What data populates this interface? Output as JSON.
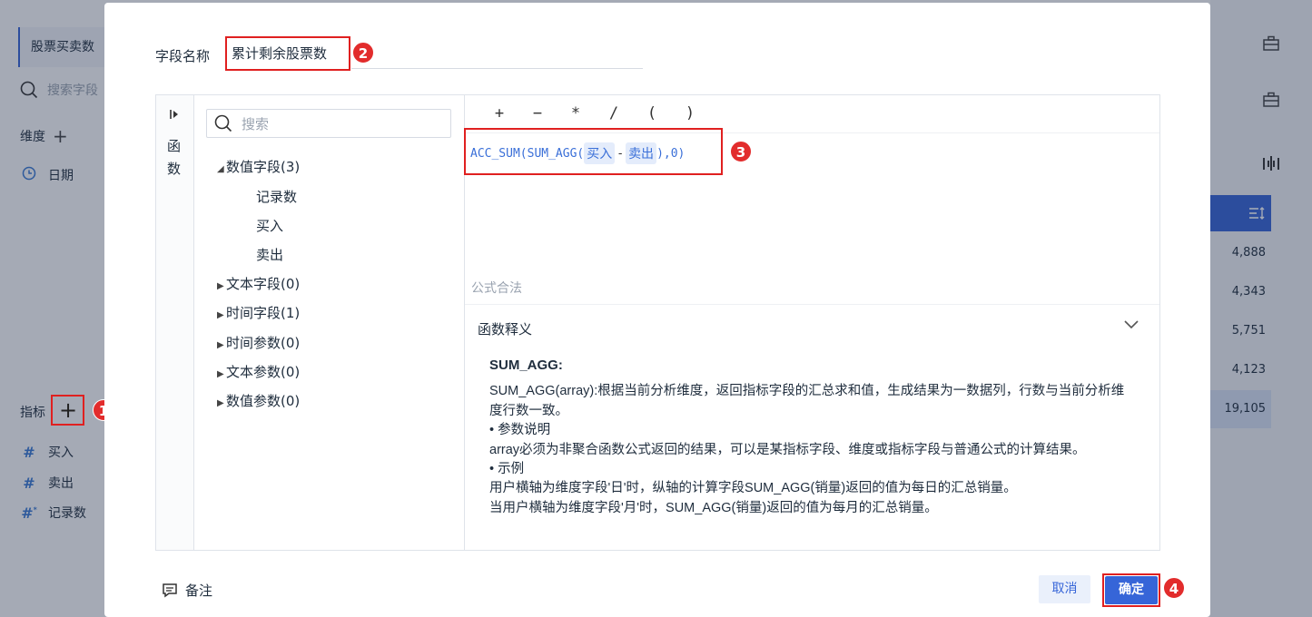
{
  "background": {
    "dataset_tab": "股票买卖数",
    "search_placeholder": "搜索字段",
    "dimension_label": "维度",
    "dimension_fields": [
      "日期"
    ],
    "metric_label": "指标",
    "metric_fields": [
      "买入",
      "卖出",
      "记录数"
    ],
    "table_values": [
      "4,888",
      "4,343",
      "5,751",
      "4,123"
    ],
    "table_total": "19,105"
  },
  "dialog": {
    "name_label": "字段名称",
    "name_value": "累计剩余股票数",
    "side_tab": "函数",
    "tree_search_placeholder": "搜索",
    "tree": {
      "numeric_group": "数值字段(3)",
      "numeric_children": [
        "记录数",
        "买入",
        "卖出"
      ],
      "text_group": "文本字段(0)",
      "time_group": "时间字段(1)",
      "time_param_group": "时间参数(0)",
      "text_param_group": "文本参数(0)",
      "numeric_param_group": "数值参数(0)"
    },
    "operators": [
      "+",
      "−",
      "*",
      "/",
      "(",
      ")"
    ],
    "formula": {
      "prefix": "ACC_SUM(SUM_AGG(",
      "field1": "买入",
      "minus": "-",
      "field2": "卖出",
      "suffix": "),0)"
    },
    "status": "公式合法",
    "explain_title": "函数释义",
    "explain": {
      "name": "SUM_AGG:",
      "lines": [
        "SUM_AGG(array):根据当前分析维度，返回指标字段的汇总求和值，生成结果为一数据列，行数与当前分析维度行数一致。",
        "• 参数说明",
        "array必须为非聚合函数公式返回的结果，可以是某指标字段、维度或指标字段与普通公式的计算结果。",
        "• 示例",
        "用户横轴为维度字段'日'时，纵轴的计算字段SUM_AGG(销量)返回的值为每日的汇总销量。",
        "当用户横轴为维度字段'月'时，SUM_AGG(销量)返回的值为每月的汇总销量。"
      ]
    },
    "note_label": "备注",
    "cancel_label": "取消",
    "ok_label": "确定"
  },
  "badges": [
    "1",
    "2",
    "3",
    "4"
  ],
  "colors": {
    "primary": "#3665d8",
    "highlight": "#e02020",
    "token_bg": "#e4ecfb"
  }
}
